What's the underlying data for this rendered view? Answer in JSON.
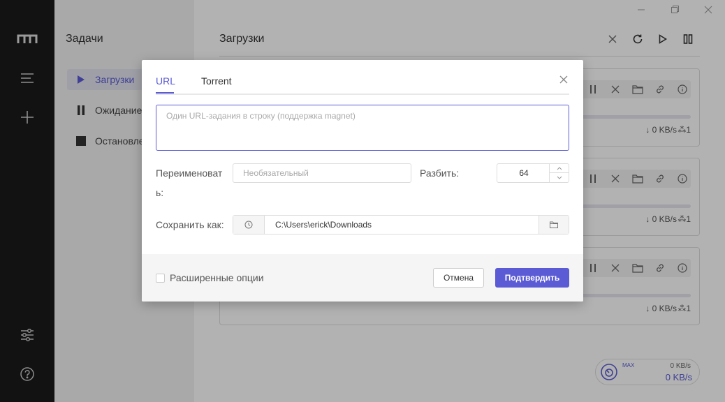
{
  "rail": {
    "icons": [
      "logo-icon",
      "menu-icon",
      "add-icon",
      "settings-sliders-icon",
      "help-icon"
    ]
  },
  "tasks": {
    "title": "Задачи",
    "items": [
      {
        "label": "Загрузки",
        "icon": "play-icon",
        "active": true
      },
      {
        "label": "Ожидание",
        "icon": "pause-icon",
        "active": false
      },
      {
        "label": "Остановле",
        "icon": "stop-icon",
        "active": false
      }
    ]
  },
  "main": {
    "title": "Загрузки",
    "cards": [
      {
        "speed": "↓ 0 KB/s",
        "connections": "1"
      },
      {
        "speed": "↓ 0 KB/s",
        "connections": "1"
      },
      {
        "speed": "↓ 0 KB/s",
        "connections": "1"
      }
    ],
    "meter": {
      "max_label": "MAX",
      "limit": "0 KB/s",
      "current": "0 KB/s"
    }
  },
  "dialog": {
    "tabs": [
      {
        "label": "URL",
        "active": true
      },
      {
        "label": "Torrent",
        "active": false
      }
    ],
    "url_placeholder": "Один URL-задания в строку (поддержка magnet)",
    "rename_label_1": "Переименоват",
    "rename_label_2": "ь:",
    "rename_placeholder": "Необязательный",
    "split_label": "Разбить:",
    "split_value": "64",
    "save_label": "Сохранить как:",
    "save_path": "C:\\Users\\erick\\Downloads",
    "advanced_label": "Расширенные опции",
    "cancel_label": "Отмена",
    "confirm_label": "Подтвердить"
  },
  "colors": {
    "accent": "#5b5bd6",
    "rail": "#1a1a1a",
    "sidebar": "#f2f2f2"
  }
}
